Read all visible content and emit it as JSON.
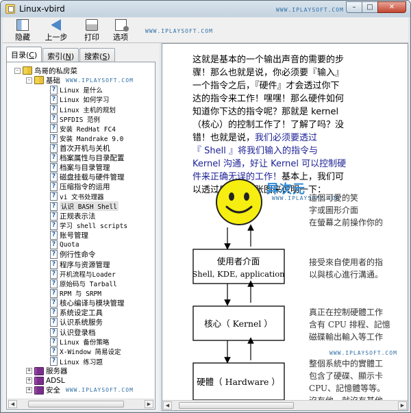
{
  "window": {
    "title": "Linux-vbird",
    "watermark": "WWW.IPLAYSOFT.COM",
    "caption": {
      "minimize": "–",
      "maximize": "□",
      "close": "✕"
    }
  },
  "toolbar": {
    "hide": "隐藏",
    "back": "上一步",
    "print": "打印",
    "options": "选项",
    "watermark": "WWW.IPLAYSOFT.COM"
  },
  "sidebar": {
    "tabs": [
      {
        "label": "目录",
        "key": "C"
      },
      {
        "label": "索引",
        "key": "N"
      },
      {
        "label": "搜索",
        "key": "S"
      }
    ],
    "root": {
      "label": "鸟哥的私房菜"
    },
    "basics": {
      "label": "基础",
      "watermark": "WWW.IPLAYSOFT.COM"
    },
    "items": [
      "Linux 是什么",
      "Linux 如何学习",
      "Linux 主机的规划",
      "SPFDIS 范例",
      "安装 RedHat FC4",
      "安装 Mandrake 9.0",
      "首次开机与关机",
      "档案属性与目录配置",
      "档案与目录管理",
      "磁盘挂载与硬件管理",
      "压缩指令的运用",
      "vi 文书处理器",
      "认识 BASH Shell",
      "正规表示法",
      "学习 shell scripts",
      "账号管理",
      "Quota",
      "例行性命令",
      "程序与资源管理",
      "开机流程与Loader",
      "原始码与 Tarball",
      "RPM 与 SRPM",
      "核心编译与模块管理",
      "系统设定工具",
      "认识系统服务",
      "认识登录档",
      "Linux 备份策略",
      "X-Window 简易设定",
      "Linux 练习题"
    ],
    "collapsed": [
      {
        "label": "服务器"
      },
      {
        "label": "ADSL"
      },
      {
        "label": "安全",
        "watermark": "WWW.IPLAYSOFT.COM"
      }
    ]
  },
  "content": {
    "lines": [
      "这就是基本的一个输出声音的需要的步",
      "骤！那么也就是说，你必须要『输入』",
      "一个指令之后，『硬件』才会透过你下",
      "达的指令来工作！嘿嘿！那么硬件如何",
      "知道你下达的指令呢？那就是 kernel",
      "（核心）的控制工作了！了解了吗？没",
      "错！也就是说，"
    ],
    "blue_inline": "我们必须要透过",
    "blue_lines": [
      "『 Shell 』将我们输入的指令与",
      "Kernel 沟通，好让 Kernel 可以控制硬",
      "件来正确无误的工作！"
    ],
    "tail_inline": "基本上，我们可",
    "last_line": "以透过底下这两张图来说明一下：",
    "brand_cn": "异次元",
    "brand_en": "WWW.IPLAYSOFT.COM",
    "watermark": "WWW.IPLAYSOFT.COM",
    "diagram": {
      "boxes": [
        "使用者介面",
        "Shell, KDE, application",
        "核心（ Kernel ）",
        "硬體（ Hardware ）"
      ],
      "side": [
        "這個可愛的笑",
        "字或圖形介面",
        "在螢幕之前操作你的",
        "接受來自使用者的指",
        "以與核心進行溝通。",
        "真正在控制硬體工作",
        "含有 CPU 排程、記憶",
        "磁碟輸出輸入等工作",
        "整個系統中的實體工",
        "包含了硬碟、顯示卡",
        "CPU、記憶體等等。",
        "沒有他，就沒有其他"
      ]
    }
  }
}
